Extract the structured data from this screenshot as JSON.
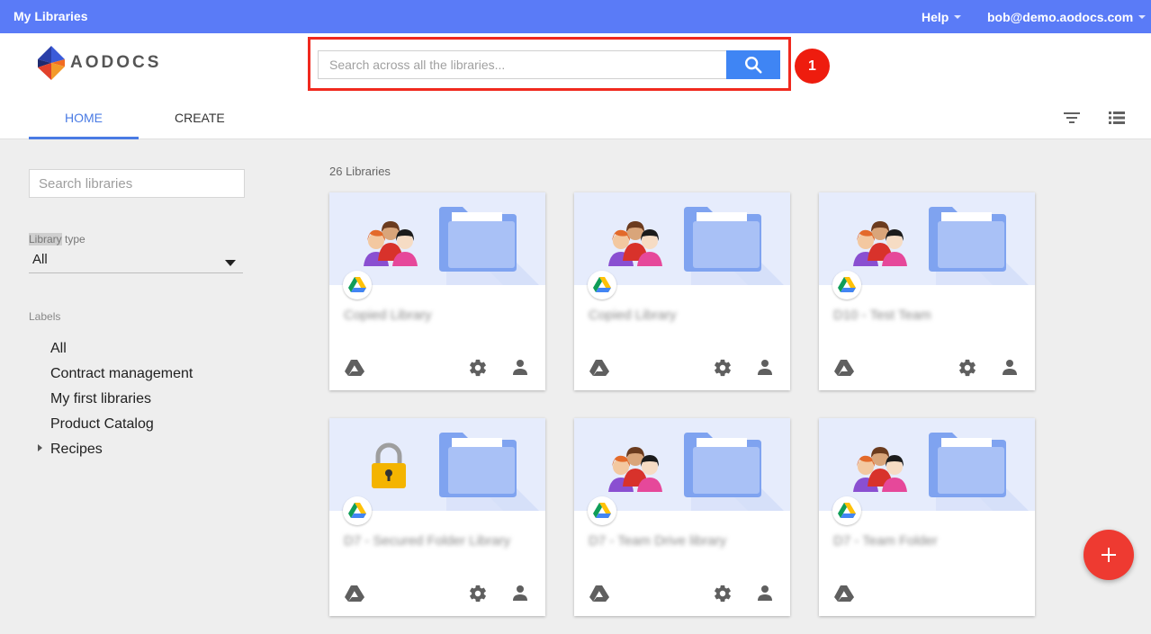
{
  "topbar": {
    "title": "My Libraries",
    "help_label": "Help",
    "user_email": "bob@demo.aodocs.com"
  },
  "header": {
    "logo_text": "AODOCS",
    "search_placeholder": "Search across all the libraries...",
    "step_number": "1",
    "tabs": [
      {
        "label": "HOME",
        "active": true
      },
      {
        "label": "CREATE",
        "active": false
      }
    ]
  },
  "sidebar": {
    "search_placeholder": "Search libraries",
    "library_type_label_highlight": "Library",
    "library_type_label_rest": " type",
    "library_type_value": "All",
    "labels_header": "Labels",
    "labels": [
      "All",
      "Contract management",
      "My first libraries",
      "Product Catalog",
      "Recipes"
    ]
  },
  "main": {
    "library_count": "26 Libraries",
    "cards": [
      {
        "name": "Copied Library",
        "banner": "team",
        "has_gear": true,
        "has_person": true
      },
      {
        "name": "Copied Library",
        "banner": "team",
        "has_gear": true,
        "has_person": true
      },
      {
        "name": "D10 - Test Team",
        "banner": "team",
        "has_gear": true,
        "has_person": true
      },
      {
        "name": "D7 - Secured Folder Library",
        "banner": "lock",
        "has_gear": true,
        "has_person": true
      },
      {
        "name": "D7 - Team Drive library",
        "banner": "team",
        "has_gear": true,
        "has_person": true
      },
      {
        "name": "D7 - Team Folder",
        "banner": "team",
        "has_gear": false,
        "has_person": false
      }
    ]
  },
  "colors": {
    "topbar": "#5a7bf7",
    "accent": "#4a7be4",
    "search_button": "#3f85f4",
    "highlight": "#f0291e",
    "fab": "#ee3a31"
  }
}
